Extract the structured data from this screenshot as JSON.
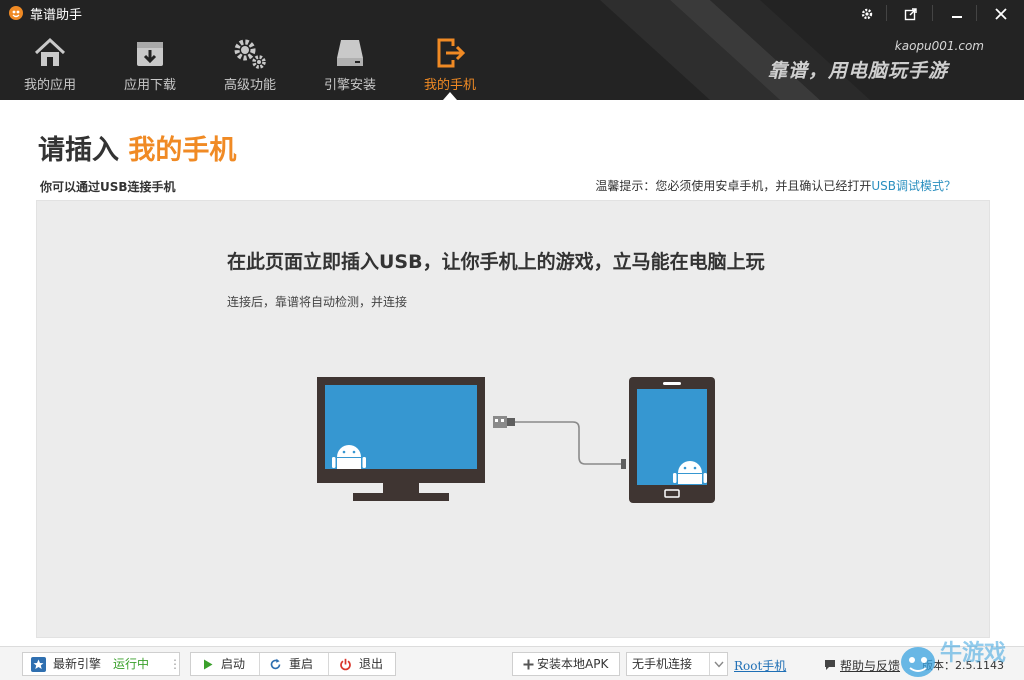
{
  "window": {
    "title": "靠谱助手",
    "controls": [
      "settings-icon",
      "restore-icon",
      "minimize-icon",
      "close-icon"
    ]
  },
  "nav": {
    "items": [
      {
        "label": "我的应用",
        "icon": "home-icon",
        "active": false
      },
      {
        "label": "应用下载",
        "icon": "download-box-icon",
        "active": false
      },
      {
        "label": "高级功能",
        "icon": "gears-icon",
        "active": false
      },
      {
        "label": "引擎安装",
        "icon": "harddrive-icon",
        "active": false
      },
      {
        "label": "我的手机",
        "icon": "phone-exit-icon",
        "active": true
      }
    ]
  },
  "brand": {
    "url": "kaopu001.com",
    "slogan": "靠谱，用电脑玩手游"
  },
  "page": {
    "title_prefix": "请插入",
    "title_accent": "我的手机",
    "subtitle": "你可以通过USB连接手机",
    "tip_prefix": "温馨提示：您必须使用安卓手机，并且确认已经打开",
    "tip_link": "USB调试模式？"
  },
  "panel": {
    "headline": "在此页面立即插入USB，让你手机上的游戏，立马能在电脑上玩",
    "note": "连接后，靠谱将自动检测，并连接"
  },
  "statusbar": {
    "engine_label": "最新引擎",
    "engine_status": "运行中",
    "start": "启动",
    "restart": "重启",
    "exit": "退出",
    "install_apk": "安装本地APK",
    "phone_select": "无手机连接",
    "root": "Root手机",
    "help": "帮助与反馈",
    "version": "版本：2.5.1143"
  },
  "colors": {
    "accent": "#f08a24",
    "header_bg": "#232323",
    "panel_bg": "#ececec",
    "screen_blue": "#3697d1",
    "device_dark": "#3f3532",
    "status_green": "#3aa02b",
    "link_blue": "#1f6fb5"
  }
}
